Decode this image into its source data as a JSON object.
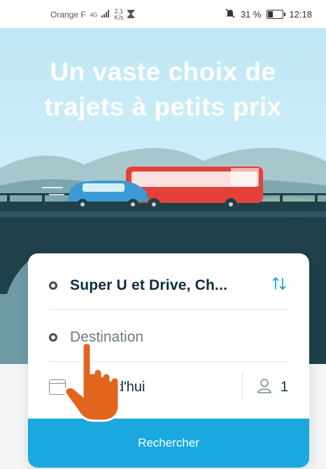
{
  "status_bar": {
    "carrier": "Orange F",
    "network": "4G",
    "speed_value": "2,1",
    "speed_unit": "K/s",
    "battery_percent": "31 %",
    "battery_level": 0.31,
    "time": "12:18"
  },
  "hero": {
    "title_line1": "Un vaste choix de",
    "title_line2": "trajets à petits prix"
  },
  "search_form": {
    "from_value": "Super U et Drive, Ch...",
    "to_placeholder": "Destination",
    "date_value": "Aujourd'hui",
    "date_visible_fragment": "rd'hui",
    "passengers": "1",
    "search_label": "Rechercher"
  },
  "colors": {
    "accent": "#1aa8df",
    "text_dark": "#0a2e3f",
    "bus_red": "#e5413b",
    "car_blue": "#3d9ad4",
    "hand_orange": "#e2651d"
  }
}
